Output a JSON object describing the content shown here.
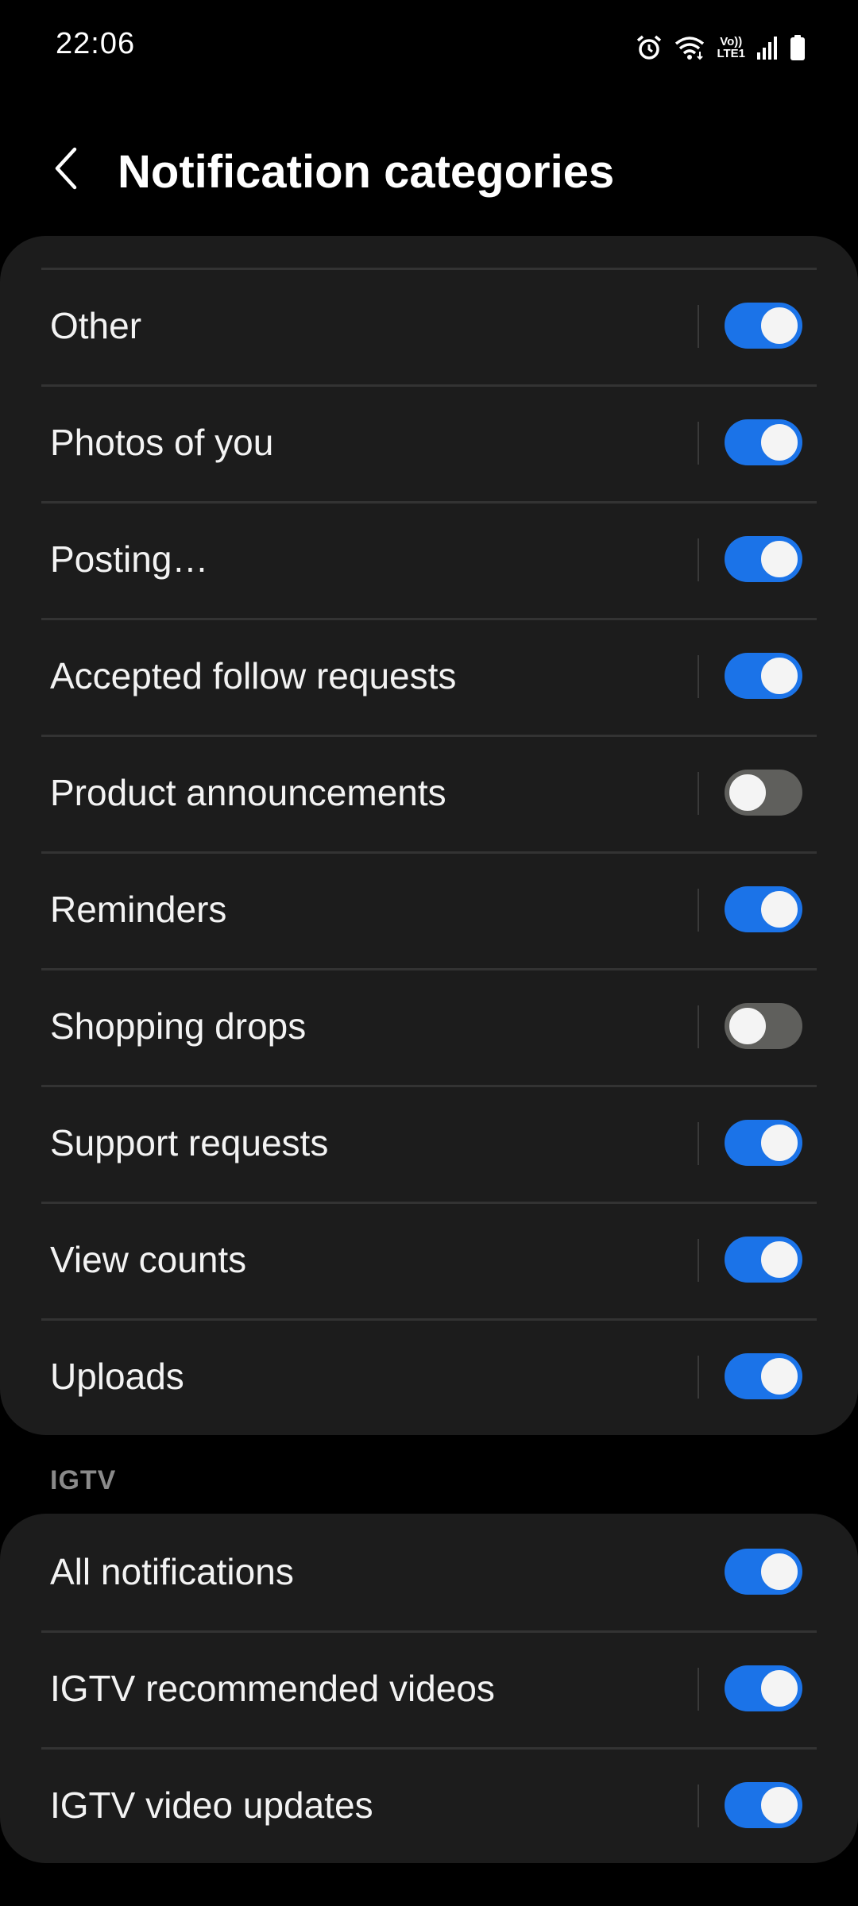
{
  "status_bar": {
    "time": "22:06",
    "network_badge_top": "Vo))",
    "network_badge_bottom": "LTE1",
    "icons": [
      "alarm-icon",
      "wifi-icon",
      "volte-lte-icon",
      "signal-icon",
      "battery-icon"
    ]
  },
  "header": {
    "title": "Notification categories",
    "back_icon": "back-arrow-icon"
  },
  "colors": {
    "accent": "#1b73e8",
    "toggle_off": "#5f5f5c",
    "card_bg": "#1c1c1c",
    "page_bg": "#000000"
  },
  "main_list": {
    "items": [
      {
        "label": "Other",
        "enabled": true
      },
      {
        "label": "Photos of you",
        "enabled": true
      },
      {
        "label": "Posting…",
        "enabled": true
      },
      {
        "label": "Accepted follow requests",
        "enabled": true
      },
      {
        "label": "Product announcements",
        "enabled": false
      },
      {
        "label": "Reminders",
        "enabled": true
      },
      {
        "label": "Shopping drops",
        "enabled": false
      },
      {
        "label": "Support requests",
        "enabled": true
      },
      {
        "label": "View counts",
        "enabled": true
      },
      {
        "label": "Uploads",
        "enabled": true
      }
    ]
  },
  "igtv": {
    "section_title": "IGTV",
    "items": [
      {
        "label": "All notifications",
        "enabled": true
      },
      {
        "label": "IGTV recommended videos",
        "enabled": true
      },
      {
        "label": "IGTV video updates",
        "enabled": true
      }
    ]
  }
}
